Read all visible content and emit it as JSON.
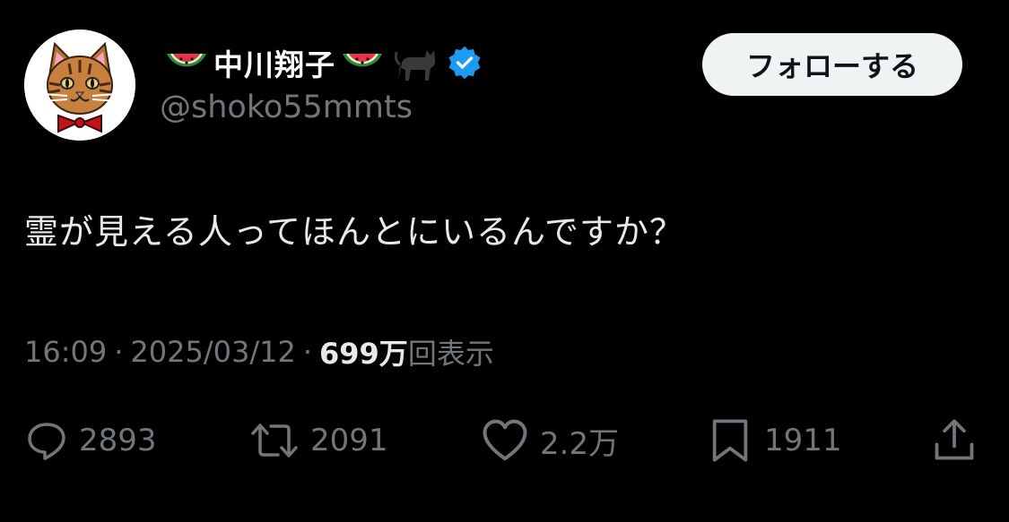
{
  "user": {
    "name": "中川翔子",
    "handle": "@shoko55mmts",
    "verified": true,
    "follow_label": "フォローする"
  },
  "tweet": {
    "text": "霊が見える人ってほんとにいるんですか？",
    "time": "16:09",
    "date": "2025/03/12",
    "views": "699万",
    "views_label": "回表示"
  },
  "actions": {
    "replies": "2893",
    "retweets": "2091",
    "likes": "2.2万",
    "bookmarks": "1911"
  },
  "colors": {
    "background": "#000000",
    "text": "#e7e9ea",
    "secondary": "#71767b",
    "verified": "#1d9bf0",
    "button_bg": "#eff3f4"
  }
}
